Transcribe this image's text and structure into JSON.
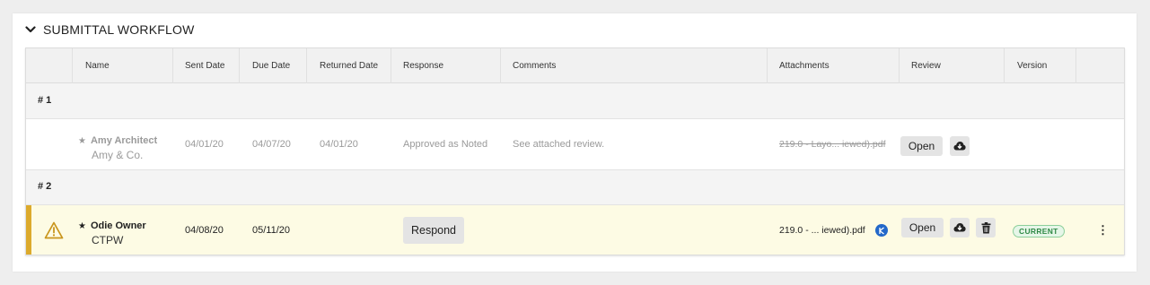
{
  "section": {
    "title": "SUBMITTAL WORKFLOW"
  },
  "columns": {
    "name": "Name",
    "sent_date": "Sent Date",
    "due_date": "Due Date",
    "returned_date": "Returned Date",
    "response": "Response",
    "comments": "Comments",
    "attachments": "Attachments",
    "review": "Review",
    "version": "Version"
  },
  "groups": [
    {
      "label": "# 1",
      "row": {
        "star": "★",
        "name": "Amy Architect",
        "company": "Amy & Co.",
        "sent_date": "04/01/20",
        "due_date": "04/07/20",
        "returned_date": "04/01/20",
        "response": "Approved as Noted",
        "comments": "See attached review.",
        "attachment": "219.0 - Layo... iewed).pdf",
        "open_label": "Open"
      }
    },
    {
      "label": "# 2",
      "row": {
        "star": "★",
        "name": "Odie Owner",
        "company": "CTPW",
        "sent_date": "04/08/20",
        "due_date": "05/11/20",
        "respond_label": "Respond",
        "attachment": "219.0 - ... iewed).pdf",
        "open_label": "Open",
        "version_badge": "CURRENT",
        "more_menu": "⋮"
      }
    }
  ],
  "icons": {
    "collapse": "chevron-down-icon",
    "warning": "warning-triangle-icon",
    "download": "cloud-download-icon",
    "delete": "trash-icon",
    "markup": "markup-icon",
    "more": "more-vertical-icon"
  },
  "colors": {
    "warning": "#dcaa2c",
    "current_badge": "#2f8a46",
    "markup_icon": "#2368c9",
    "highlight_row": "#fdfbe4"
  }
}
